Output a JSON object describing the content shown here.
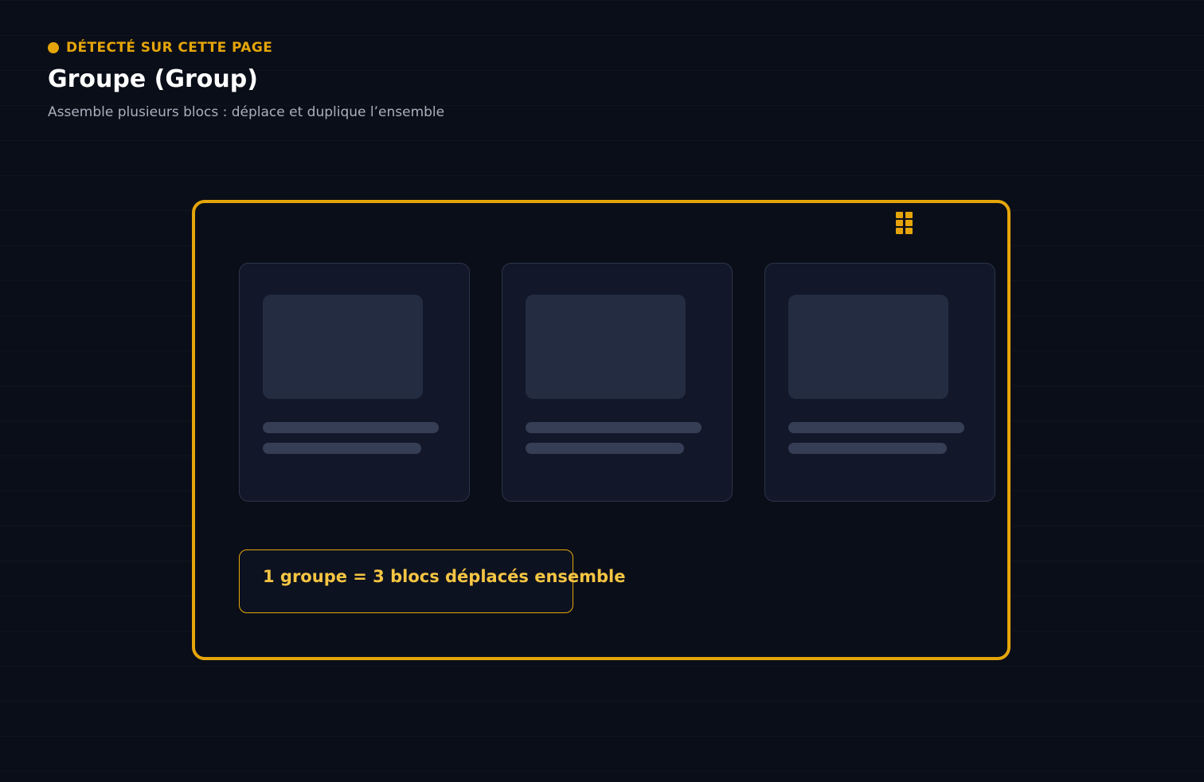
{
  "header": {
    "detected_label": "DÉTECTÉ SUR CETTE PAGE",
    "title": "Groupe (Group)",
    "subtitle": "Assemble plusieurs blocs : déplace et duplique l’ensemble"
  },
  "group": {
    "drag_handle_icon": "grip-vertical-icon",
    "blocks": [
      {
        "name": "block-1"
      },
      {
        "name": "block-2"
      },
      {
        "name": "block-3"
      }
    ],
    "info_text": "1 groupe = 3 blocs déplacés ensemble"
  },
  "colors": {
    "background": "#0a0e18",
    "accent": "#e5a50a",
    "accent_text": "#f5c543",
    "card_background": "#121829",
    "card_border": "#2b3449",
    "placeholder_image": "#242c42",
    "placeholder_line": "#363e55",
    "title": "#ffffff",
    "subtitle": "#a9afbd"
  }
}
